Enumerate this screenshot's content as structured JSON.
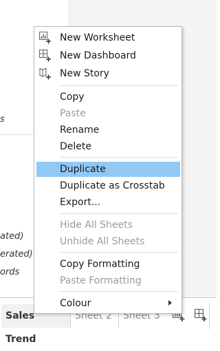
{
  "background": {
    "fragments": [
      "s",
      "ated)",
      "erated)",
      "ords"
    ]
  },
  "menu": {
    "items": [
      {
        "label": "New Worksheet",
        "icon": "new-worksheet-icon"
      },
      {
        "label": "New Dashboard",
        "icon": "new-dashboard-icon"
      },
      {
        "label": "New Story",
        "icon": "new-story-icon"
      },
      {
        "label": "Copy"
      },
      {
        "label": "Paste",
        "disabled": true
      },
      {
        "label": "Rename"
      },
      {
        "label": "Delete"
      },
      {
        "label": "Duplicate",
        "selected": true
      },
      {
        "label": "Duplicate as Crosstab"
      },
      {
        "label": "Export..."
      },
      {
        "label": "Hide All Sheets",
        "disabled": true
      },
      {
        "label": "Unhide All Sheets",
        "disabled": true
      },
      {
        "label": "Copy Formatting"
      },
      {
        "label": "Paste Formatting",
        "disabled": true
      },
      {
        "label": "Colour",
        "submenu": true
      }
    ],
    "selected_color": "#90c8f6"
  },
  "tabs": [
    {
      "label": "Sales Trend",
      "active": true
    },
    {
      "label": "Sheet 2"
    },
    {
      "label": "Sheet 3"
    }
  ]
}
